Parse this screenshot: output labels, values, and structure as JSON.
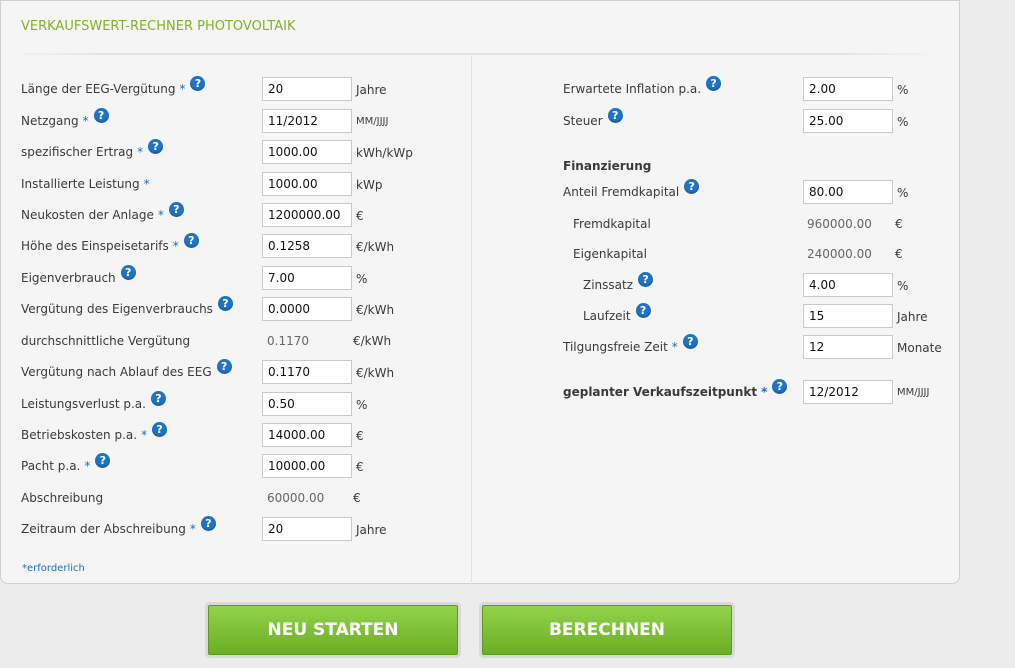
{
  "title": "VERKAUFSWERT-RECHNER PHOTOVOLTAIK",
  "required_mark": "*",
  "help_glyph": "?",
  "left": {
    "duration": {
      "label": "Länge der EEG-Vergütung",
      "value": "20",
      "unit": "Jahre"
    },
    "grid_date": {
      "label": "Netzgang",
      "value": "11/2012",
      "unit": "MM/JJJJ"
    },
    "specific_yield": {
      "label": "spezifischer Ertrag",
      "value": "1000.00",
      "unit": "kWh/kWp"
    },
    "capacity": {
      "label": "Installierte Leistung",
      "value": "1000.00",
      "unit": "kWp"
    },
    "new_cost": {
      "label": "Neukosten der Anlage",
      "value": "1200000.00",
      "unit": "€"
    },
    "feed_in_tariff": {
      "label": "Höhe des Einspeisetarifs",
      "value": "0.1258",
      "unit": "€/kWh"
    },
    "self_consumption": {
      "label": "Eigenverbrauch",
      "value": "7.00",
      "unit": "%"
    },
    "self_consumption_pay": {
      "label": "Vergütung des Eigenverbrauchs",
      "value": "0.0000",
      "unit": "€/kWh"
    },
    "avg_pay": {
      "label": "durchschnittliche Vergütung",
      "value": "0.1170",
      "unit": "€/kWh"
    },
    "post_eeg_pay": {
      "label": "Vergütung nach Ablauf des EEG",
      "value": "0.1170",
      "unit": "€/kWh"
    },
    "degradation": {
      "label": "Leistungsverlust p.a.",
      "value": "0.50",
      "unit": "%"
    },
    "opex": {
      "label": "Betriebskosten p.a.",
      "value": "14000.00",
      "unit": "€"
    },
    "lease": {
      "label": "Pacht p.a.",
      "value": "10000.00",
      "unit": "€"
    },
    "depreciation": {
      "label": "Abschreibung",
      "value": "60000.00",
      "unit": "€"
    },
    "depreciation_period": {
      "label": "Zeitraum der Abschreibung",
      "value": "20",
      "unit": "Jahre"
    },
    "footnote": "*erforderlich"
  },
  "right": {
    "inflation": {
      "label": "Erwartete Inflation p.a.",
      "value": "2.00",
      "unit": "%"
    },
    "tax": {
      "label": "Steuer",
      "value": "25.00",
      "unit": "%"
    },
    "financing_heading": "Finanzierung",
    "debt_share": {
      "label": "Anteil Fremdkapital",
      "value": "80.00",
      "unit": "%"
    },
    "debt": {
      "label": "Fremdkapital",
      "value": "960000.00",
      "unit": "€"
    },
    "equity": {
      "label": "Eigenkapital",
      "value": "240000.00",
      "unit": "€"
    },
    "interest": {
      "label": "Zinssatz",
      "value": "4.00",
      "unit": "%"
    },
    "term": {
      "label": "Laufzeit",
      "value": "15",
      "unit": "Jahre"
    },
    "grace": {
      "label": "Tilgungsfreie Zeit",
      "value": "12",
      "unit": "Monate"
    },
    "sale_date": {
      "label": "geplanter Verkaufszeitpunkt",
      "value": "12/2012",
      "unit": "MM/JJJJ"
    }
  },
  "buttons": {
    "restart": "NEU STARTEN",
    "calculate": "BERECHNEN"
  },
  "colors": {
    "title_green": "#82b02c",
    "button_green": "#7ec338",
    "help_blue": "#1f73c2"
  }
}
